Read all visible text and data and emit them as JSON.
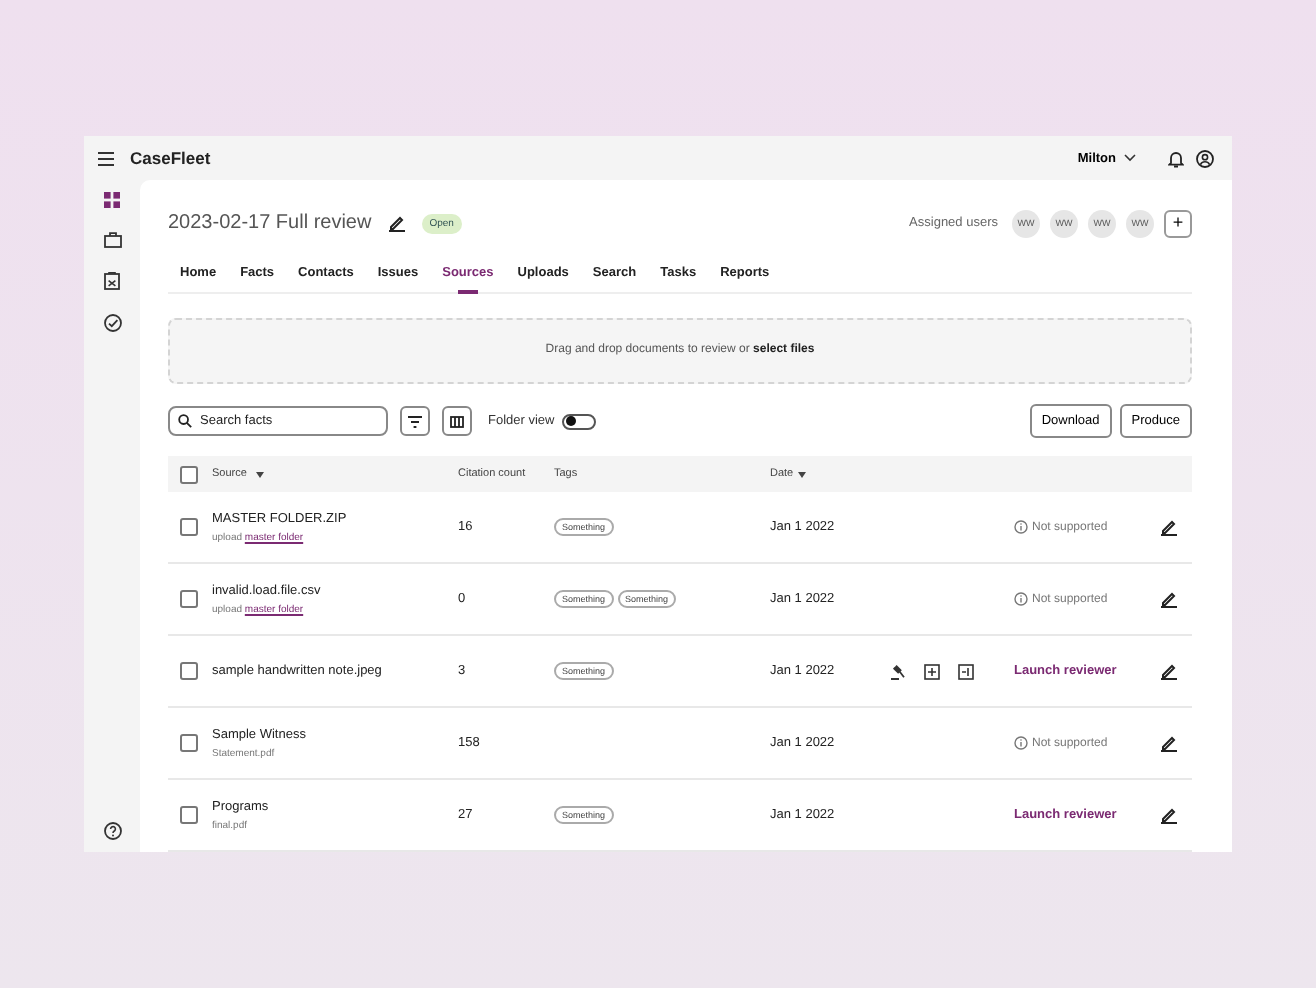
{
  "app": {
    "logo": "CaseFleet",
    "user_menu": "Milton"
  },
  "sidebar": {
    "items": [
      {
        "selected": true
      },
      {
        "selected": false
      },
      {
        "selected": false
      },
      {
        "selected": false
      }
    ]
  },
  "header": {
    "title": "2023-02-17 Full review",
    "status_badge": "Open",
    "assigned_label": "Assigned users",
    "avatars": [
      "WW",
      "WW",
      "WW",
      "WW"
    ],
    "add_button": "+"
  },
  "tabs": [
    {
      "label": "Home",
      "selected": false
    },
    {
      "label": "Facts",
      "selected": false
    },
    {
      "label": "Contacts",
      "selected": false
    },
    {
      "label": "Issues",
      "selected": false
    },
    {
      "label": "Sources",
      "selected": true
    },
    {
      "label": "Uploads",
      "selected": false
    },
    {
      "label": "Search",
      "selected": false
    },
    {
      "label": "Tasks",
      "selected": false
    },
    {
      "label": "Reports",
      "selected": false
    }
  ],
  "dropzone": {
    "text": "Drag and drop documents to review or ",
    "link": "select files"
  },
  "toolbar": {
    "search_placeholder": "Search facts",
    "folder_view_label": "Folder view",
    "folder_view_on": false,
    "buttons": [
      "Download",
      "Produce"
    ]
  },
  "table": {
    "header_checked": false,
    "columns": [
      "Source",
      "Citation count",
      "Tags",
      "Date"
    ],
    "rows": [
      {
        "checked": false,
        "name": "MASTER FOLDER.ZIP",
        "sub": "upload ",
        "sub_link": "master folder",
        "count": "16",
        "tags": [
          "Something"
        ],
        "date": "Jan 1 2022",
        "tools_shown": false,
        "kind": "unsupported",
        "action": "Not supported"
      },
      {
        "checked": false,
        "name": "invalid.load.file.csv",
        "sub": "upload ",
        "sub_link": "master folder",
        "count": "0",
        "tags": [
          "Something",
          "Something"
        ],
        "date": "Jan 1 2022",
        "tools_shown": false,
        "kind": "unsupported",
        "action": "Not supported"
      },
      {
        "checked": false,
        "name": "sample handwritten note.jpeg",
        "count": "3",
        "tags": [
          "Something"
        ],
        "date": "Jan 1 2022",
        "tools_shown": true,
        "kind": "reviewer",
        "action": "Launch reviewer"
      },
      {
        "checked": false,
        "name": "Sample Witness",
        "sub": "Statement.pdf",
        "count": "158",
        "tags": [],
        "date": "Jan 1 2022",
        "tools_shown": false,
        "kind": "unsupported",
        "action": "Not supported"
      },
      {
        "checked": false,
        "name": "Programs",
        "sub": "final.pdf",
        "count": "27",
        "tags": [
          "Something"
        ],
        "date": "Jan 1 2022",
        "tools_shown": false,
        "kind": "reviewer",
        "action": "Launch reviewer"
      }
    ]
  }
}
